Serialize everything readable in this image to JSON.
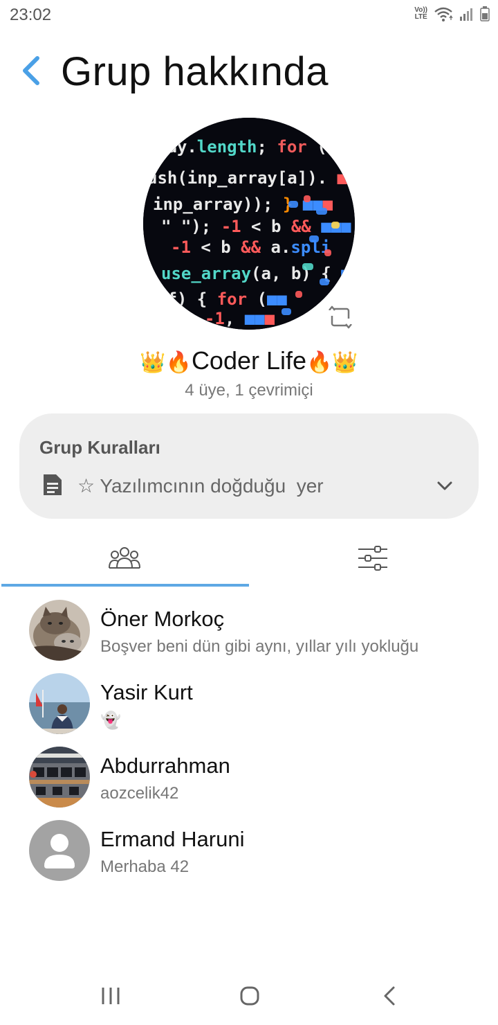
{
  "status_bar": {
    "time": "23:02",
    "volte_top": "Vo))",
    "volte_bottom": "LTE",
    "icons": [
      "wifi-icon",
      "signal-icon",
      "battery-icon"
    ]
  },
  "header": {
    "title": "Grup hakkında",
    "back_icon": "chevron-left-icon"
  },
  "group": {
    "avatar_alt": "code screen photo",
    "name_emoji_left": "👑🔥",
    "name": "Coder Life",
    "name_emoji_right": "🔥👑",
    "member_count": "4 üye, 1 çevrimiçi",
    "change_photo_icon": "change-photo-icon"
  },
  "rules": {
    "title": "Grup Kuralları",
    "text": "☆ Yazılımcının doğduğu  yer",
    "icon": "document-icon",
    "expand_icon": "chevron-down-icon"
  },
  "tabs": [
    {
      "icon": "members-icon",
      "active": true
    },
    {
      "icon": "sliders-icon",
      "active": false
    }
  ],
  "members": [
    {
      "name": "Öner Morkoç",
      "status": "Boşver beni dün gibi aynı, yıllar yılı yokluğu",
      "avatar": "cat-photo"
    },
    {
      "name": "Yasir Kurt",
      "status": "👻",
      "avatar": "seaside-photo"
    },
    {
      "name": "Abdurrahman",
      "status": "aozcelik42",
      "avatar": "office-photo"
    },
    {
      "name": "Ermand Haruni",
      "status": "Merhaba 42",
      "avatar": "default-person-icon"
    }
  ],
  "colors": {
    "accent": "#5ea8e4",
    "card_bg": "#eeeeee",
    "secondary_text": "#777777"
  },
  "nav_bar": {
    "icons": [
      "recent-apps-icon",
      "home-icon",
      "back-icon"
    ]
  }
}
